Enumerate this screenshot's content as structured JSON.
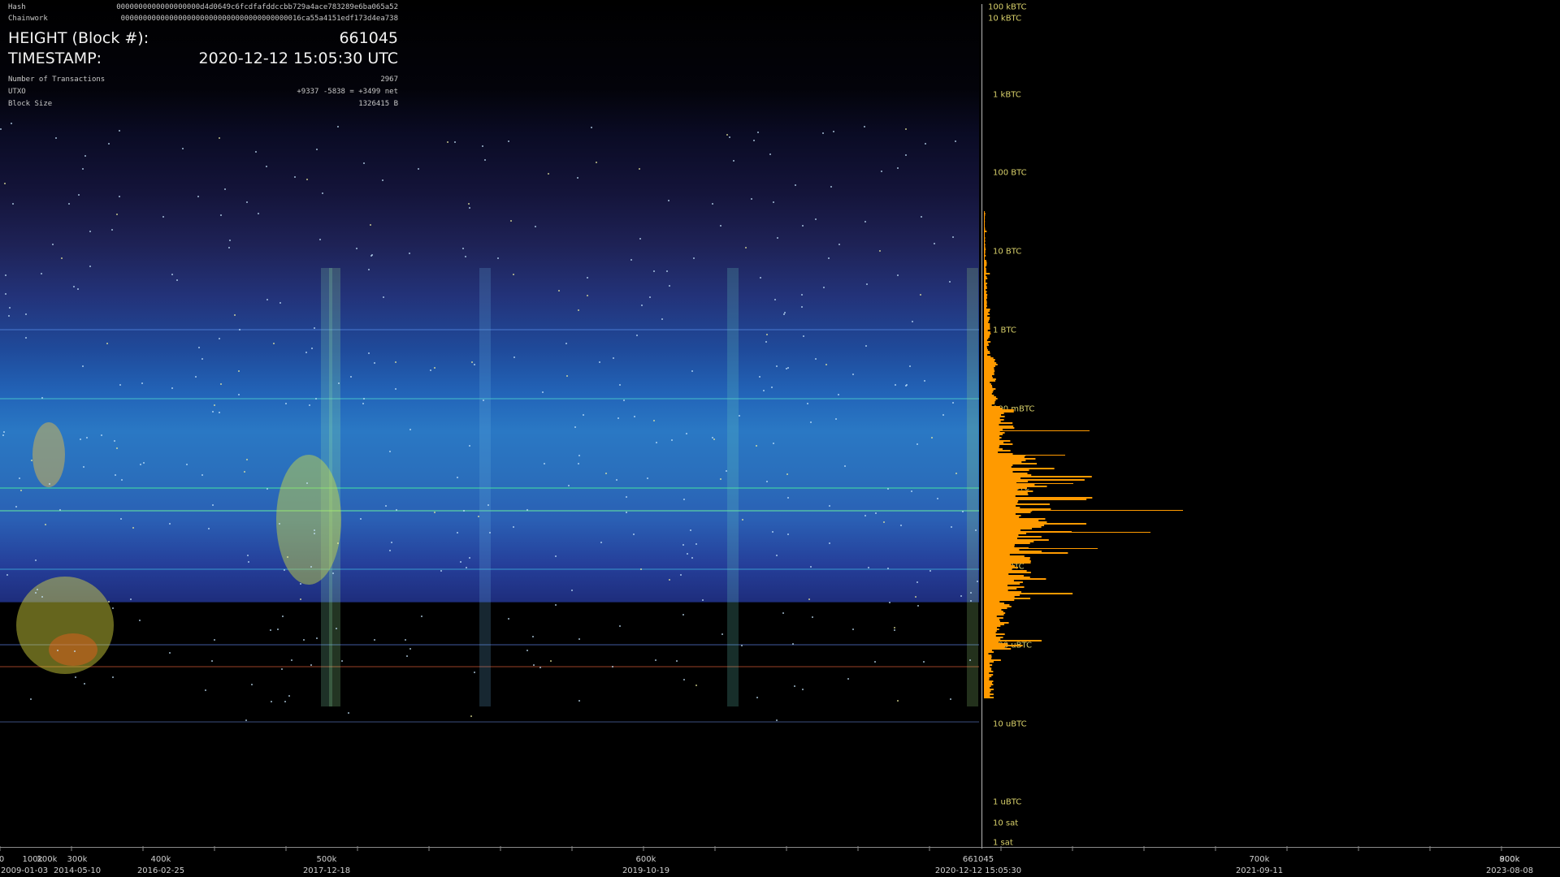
{
  "header": {
    "hash_label": "Hash",
    "hash_value": "0000000000000000000d4d0649c6fcdfafddccbb729a4ace783289e6ba065a52",
    "chainwork_label": "Chainwork",
    "chainwork_value": "00000000000000000000000000000000000000016ca55a4151edf173d4ea738",
    "height_label": "HEIGHT (Block #):",
    "height_value": "661045",
    "timestamp_label": "TIMESTAMP:",
    "timestamp_value": "2020-12-12 15:05:30 UTC",
    "tx_label": "Number of Transactions",
    "tx_value": "2967",
    "utxo_label": "UTXO",
    "utxo_value": "+9337 -5838 = +3499 net",
    "size_label": "Block Size",
    "size_value": "1326415 B"
  },
  "colors": {
    "background": "#000000",
    "histogram": "#ff9a00",
    "axis_label": "#d8d06a"
  },
  "chart_data": {
    "type": "heatmap",
    "title": "",
    "xlabel": "",
    "ylabel": "",
    "y_scale": "log",
    "y_ticks": [
      "100 kBTC",
      "10 kBTC",
      "1 kBTC",
      "100 BTC",
      "10 BTC",
      "1 BTC",
      "100 mBTC",
      "10 mBTC",
      "1 mBTC",
      "100 uBTC",
      "10 uBTC",
      "1 uBTC",
      "10 sat",
      "1 sat"
    ],
    "x_ticks": [
      "0",
      "100k",
      "200k",
      "300k",
      "400k",
      "500k",
      "600k",
      "661045",
      "700k",
      "800k",
      "900k"
    ],
    "x_dates": [
      "2009-01-03",
      "2014-05-10",
      "2016-02-25",
      "2017-12-18",
      "2019-10-19",
      "2020-12-12 15:05:30",
      "2021-09-11",
      "2023-08-08"
    ],
    "xlim": [
      0,
      900000
    ],
    "current_block": 661045,
    "histogram_series": {
      "name": "",
      "description_values_relative": [
        0.02,
        0.05,
        0.1,
        0.2,
        0.45,
        0.8,
        1.0,
        0.7,
        0.4,
        0.15
      ]
    },
    "grid": false
  }
}
